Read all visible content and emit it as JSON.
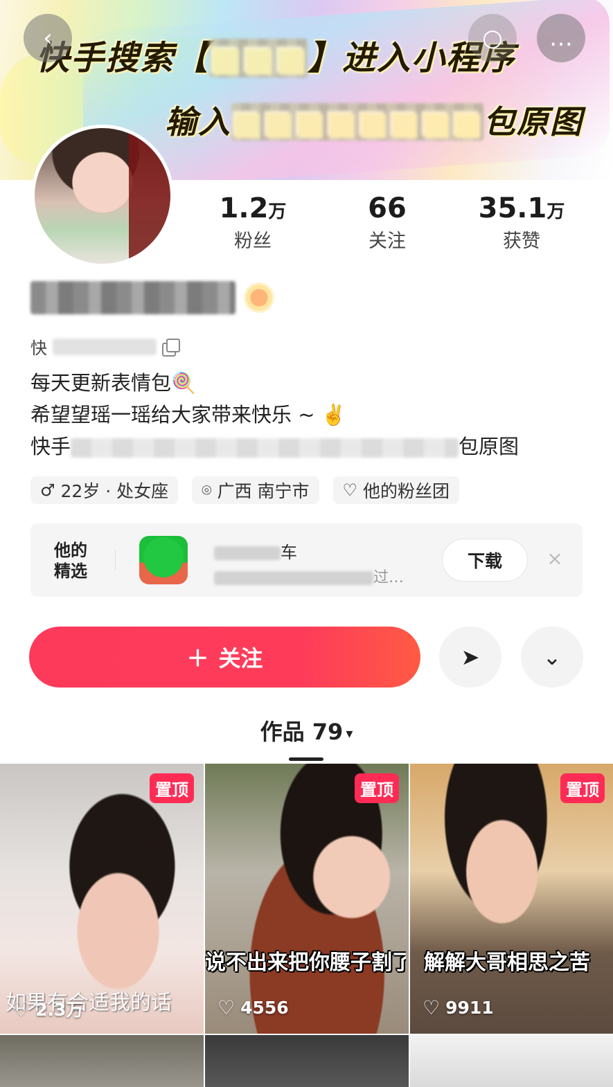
{
  "banner": {
    "line1_prefix": "快手搜索【",
    "line1_blur": "■■■",
    "line1_suffix": "】进入小程序",
    "line2_prefix": "输入",
    "line2_blur": "■■■■■■■■",
    "line2_suffix": "包原图"
  },
  "nav": {
    "back_icon": "‹",
    "search_icon": "○",
    "more_icon": "…"
  },
  "stats": [
    {
      "num": "1.2",
      "unit": "万",
      "label": "粉丝"
    },
    {
      "num": "66",
      "unit": "",
      "label": "关注"
    },
    {
      "num": "35.1",
      "unit": "万",
      "label": "获赞"
    }
  ],
  "profile": {
    "name_blur": "■■■■■■",
    "kid_prefix": "快",
    "bio_line1": "每天更新表情包🍭",
    "bio_line2": "希望望瑶一瑶给大家带来快乐 ~ ✌️",
    "bio_line3_prefix": "快手",
    "bio_line3_suffix": "包原图"
  },
  "tags": [
    {
      "icon": "♂",
      "text": "22岁 · 处女座"
    },
    {
      "icon": "⌾",
      "text": "广西 南宁市"
    },
    {
      "icon": "♡",
      "text": "他的粉丝团"
    }
  ],
  "selection": {
    "title_line1": "他的",
    "title_line2": "精选",
    "app_name_suffix": "车",
    "app_desc_suffix": "过…",
    "download_label": "下载",
    "close_icon": "×"
  },
  "actions": {
    "follow_plus": "＋",
    "follow_label": "关注",
    "share_icon": "➤",
    "expand_icon": "⌄"
  },
  "works": {
    "label": "作品 79",
    "caret": "▾"
  },
  "videos": [
    {
      "pinned": "置顶",
      "caption": "如果有合适我的话",
      "likes": "2.3万"
    },
    {
      "pinned": "置顶",
      "caption": "说不出来把你腰子割了",
      "likes": "4556"
    },
    {
      "pinned": "置顶",
      "caption": "解解大哥相思之苦",
      "likes": "9911"
    }
  ],
  "icons": {
    "heart": "♡"
  },
  "colors": {
    "accent": "#fe2c55",
    "follow_gradient_end": "#ff5a44"
  }
}
